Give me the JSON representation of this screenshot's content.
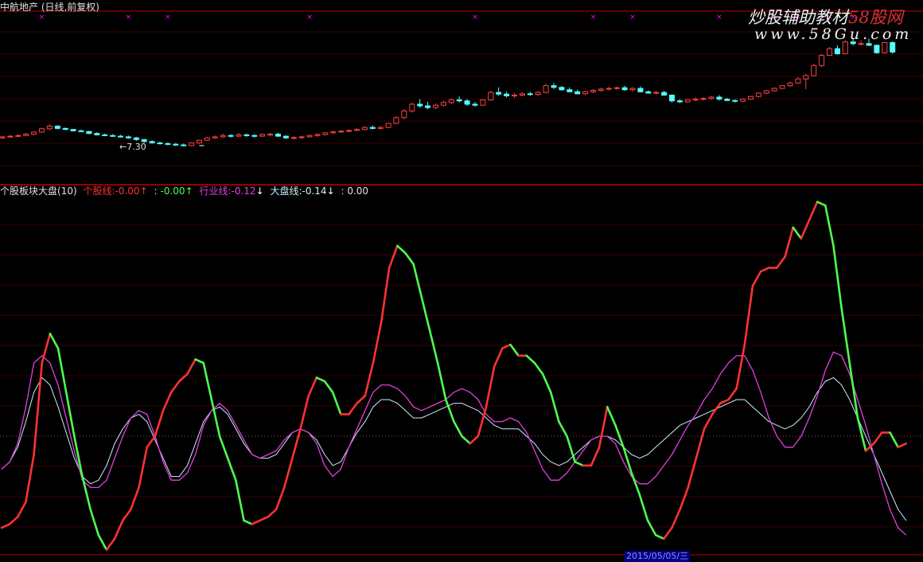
{
  "window": {
    "title": "中航地产 (日线,前复权)",
    "bottom_date": "2015/05/05/三"
  },
  "watermark": {
    "line1_part1": "炒股辅助教材",
    "line1_part2": "58股网",
    "line2": "www.58Gu.com"
  },
  "indicator_header": {
    "name": "个股板块大盘(10)",
    "items": [
      {
        "label": "个股线:",
        "value": "-0.00",
        "arrow": "↑",
        "color": "#ff3232"
      },
      {
        "label": ":",
        "value": "-0.00",
        "arrow": "↑",
        "color": "#4dff4d"
      },
      {
        "label": "行业线:",
        "value": "-0.12",
        "arrow": "↓",
        "color": "#e040e0"
      },
      {
        "label": "大盘线:",
        "value": "-0.14",
        "arrow": "↓",
        "color": "#c8f0ff"
      },
      {
        "label": ":",
        "value": "0.00",
        "arrow": "",
        "color": "#e0e0e0"
      }
    ]
  },
  "colors": {
    "stock_up": "#ff3232",
    "stock_down": "#4dff4d",
    "industry": "#e040e0",
    "market": "#c8f0ff",
    "candle_up": "#ff4040",
    "candle_down": "#54ffff",
    "divider": "#c00000",
    "grid": "#3a0000",
    "marker": "#ff00ff"
  },
  "chart_data": [
    {
      "type": "candlestick",
      "title": "中航地产 (日线,前复权)",
      "annotations": [
        {
          "text": "←7.30",
          "x": 25
        }
      ],
      "markers_x": [
        5,
        16,
        21,
        39,
        60,
        75,
        80,
        91,
        98,
        101,
        105,
        108,
        135,
        138,
        140
      ],
      "ohlc": [
        [
          7.55,
          7.6,
          7.52,
          7.58
        ],
        [
          7.58,
          7.63,
          7.55,
          7.6
        ],
        [
          7.6,
          7.65,
          7.57,
          7.62
        ],
        [
          7.62,
          7.7,
          7.6,
          7.66
        ],
        [
          7.66,
          7.75,
          7.63,
          7.72
        ],
        [
          7.72,
          7.85,
          7.7,
          7.82
        ],
        [
          7.82,
          7.95,
          7.78,
          7.9
        ],
        [
          7.9,
          7.92,
          7.8,
          7.83
        ],
        [
          7.83,
          7.86,
          7.78,
          7.8
        ],
        [
          7.8,
          7.82,
          7.74,
          7.76
        ],
        [
          7.76,
          7.8,
          7.72,
          7.74
        ],
        [
          7.74,
          7.76,
          7.66,
          7.68
        ],
        [
          7.68,
          7.72,
          7.62,
          7.64
        ],
        [
          7.64,
          7.68,
          7.6,
          7.62
        ],
        [
          7.62,
          7.66,
          7.58,
          7.6
        ],
        [
          7.6,
          7.64,
          7.56,
          7.58
        ],
        [
          7.58,
          7.62,
          7.52,
          7.55
        ],
        [
          7.55,
          7.58,
          7.46,
          7.5
        ],
        [
          7.5,
          7.52,
          7.4,
          7.44
        ],
        [
          7.44,
          7.48,
          7.38,
          7.4
        ],
        [
          7.4,
          7.44,
          7.35,
          7.38
        ],
        [
          7.38,
          7.42,
          7.33,
          7.36
        ],
        [
          7.36,
          7.4,
          7.31,
          7.34
        ],
        [
          7.34,
          7.38,
          7.3,
          7.32
        ],
        [
          7.32,
          7.42,
          7.3,
          7.4
        ],
        [
          7.4,
          7.5,
          7.38,
          7.48
        ],
        [
          7.48,
          7.58,
          7.46,
          7.55
        ],
        [
          7.55,
          7.62,
          7.52,
          7.58
        ],
        [
          7.58,
          7.68,
          7.55,
          7.62
        ],
        [
          7.62,
          7.66,
          7.56,
          7.6
        ],
        [
          7.6,
          7.7,
          7.58,
          7.64
        ],
        [
          7.64,
          7.68,
          7.58,
          7.62
        ],
        [
          7.62,
          7.66,
          7.56,
          7.6
        ],
        [
          7.6,
          7.68,
          7.58,
          7.65
        ],
        [
          7.65,
          7.7,
          7.6,
          7.66
        ],
        [
          7.66,
          7.7,
          7.58,
          7.6
        ],
        [
          7.6,
          7.62,
          7.52,
          7.55
        ],
        [
          7.55,
          7.6,
          7.5,
          7.56
        ],
        [
          7.56,
          7.62,
          7.52,
          7.58
        ],
        [
          7.58,
          7.64,
          7.55,
          7.62
        ],
        [
          7.62,
          7.68,
          7.58,
          7.65
        ],
        [
          7.65,
          7.72,
          7.62,
          7.7
        ],
        [
          7.7,
          7.76,
          7.66,
          7.73
        ],
        [
          7.73,
          7.78,
          7.7,
          7.75
        ],
        [
          7.75,
          7.8,
          7.72,
          7.77
        ],
        [
          7.77,
          7.84,
          7.74,
          7.8
        ],
        [
          7.8,
          7.9,
          7.78,
          7.86
        ],
        [
          7.86,
          7.92,
          7.8,
          7.83
        ],
        [
          7.83,
          7.9,
          7.8,
          7.86
        ],
        [
          7.86,
          8.0,
          7.84,
          7.98
        ],
        [
          7.98,
          8.2,
          7.96,
          8.15
        ],
        [
          8.15,
          8.4,
          8.1,
          8.35
        ],
        [
          8.35,
          8.6,
          8.3,
          8.55
        ],
        [
          8.55,
          8.7,
          8.45,
          8.5
        ],
        [
          8.5,
          8.62,
          8.4,
          8.45
        ],
        [
          8.45,
          8.58,
          8.4,
          8.52
        ],
        [
          8.52,
          8.66,
          8.48,
          8.6
        ],
        [
          8.6,
          8.72,
          8.55,
          8.68
        ],
        [
          8.68,
          8.78,
          8.6,
          8.65
        ],
        [
          8.65,
          8.7,
          8.5,
          8.55
        ],
        [
          8.55,
          8.62,
          8.48,
          8.52
        ],
        [
          8.52,
          8.7,
          8.5,
          8.68
        ],
        [
          8.68,
          8.95,
          8.65,
          8.9
        ],
        [
          8.9,
          9.05,
          8.8,
          8.85
        ],
        [
          8.85,
          8.92,
          8.75,
          8.8
        ],
        [
          8.8,
          8.88,
          8.74,
          8.82
        ],
        [
          8.82,
          8.9,
          8.78,
          8.86
        ],
        [
          8.86,
          8.92,
          8.8,
          8.84
        ],
        [
          8.84,
          8.94,
          8.8,
          8.9
        ],
        [
          8.9,
          9.15,
          8.88,
          9.1
        ],
        [
          9.1,
          9.18,
          9.0,
          9.05
        ],
        [
          9.05,
          9.1,
          8.95,
          8.98
        ],
        [
          8.98,
          9.05,
          8.9,
          8.92
        ],
        [
          8.92,
          8.98,
          8.84,
          8.86
        ],
        [
          8.86,
          8.95,
          8.82,
          8.92
        ],
        [
          8.92,
          9.0,
          8.88,
          8.96
        ],
        [
          8.96,
          9.04,
          8.92,
          9.0
        ],
        [
          9.0,
          9.06,
          8.96,
          9.02
        ],
        [
          9.02,
          9.08,
          8.98,
          9.04
        ],
        [
          9.04,
          9.1,
          8.95,
          8.98
        ],
        [
          8.98,
          9.05,
          8.92,
          9.02
        ],
        [
          9.02,
          9.08,
          8.9,
          8.92
        ],
        [
          8.92,
          8.96,
          8.86,
          8.88
        ],
        [
          8.88,
          8.94,
          8.84,
          8.9
        ],
        [
          8.9,
          8.95,
          8.8,
          8.82
        ],
        [
          8.82,
          8.84,
          8.6,
          8.65
        ],
        [
          8.65,
          8.7,
          8.58,
          8.62
        ],
        [
          8.62,
          8.7,
          8.6,
          8.68
        ],
        [
          8.68,
          8.75,
          8.64,
          8.7
        ],
        [
          8.7,
          8.76,
          8.65,
          8.72
        ],
        [
          8.72,
          8.8,
          8.68,
          8.76
        ],
        [
          8.76,
          8.82,
          8.66,
          8.7
        ],
        [
          8.7,
          8.74,
          8.64,
          8.66
        ],
        [
          8.66,
          8.7,
          8.6,
          8.64
        ],
        [
          8.64,
          8.72,
          8.62,
          8.7
        ],
        [
          8.7,
          8.8,
          8.68,
          8.78
        ],
        [
          8.78,
          8.9,
          8.76,
          8.88
        ],
        [
          8.88,
          8.98,
          8.85,
          8.95
        ],
        [
          8.95,
          9.05,
          8.92,
          9.02
        ],
        [
          9.02,
          9.12,
          9.0,
          9.1
        ],
        [
          9.1,
          9.22,
          9.06,
          9.18
        ],
        [
          9.18,
          9.35,
          9.15,
          9.3
        ],
        [
          9.3,
          9.45,
          9.0,
          9.4
        ],
        [
          9.4,
          9.75,
          9.38,
          9.7
        ],
        [
          9.7,
          10.05,
          9.65,
          10.0
        ],
        [
          10.0,
          10.25,
          9.98,
          10.2
        ],
        [
          10.2,
          10.3,
          10.02,
          10.05
        ],
        [
          10.05,
          10.45,
          10.03,
          10.4
        ],
        [
          10.4,
          10.5,
          10.3,
          10.35
        ],
        [
          10.35,
          10.45,
          10.3,
          10.35
        ],
        [
          10.35,
          10.5,
          10.28,
          10.3
        ],
        [
          10.3,
          10.32,
          10.05,
          10.08
        ],
        [
          10.08,
          10.4,
          10.06,
          10.38
        ],
        [
          10.38,
          10.42,
          10.05,
          10.1
        ]
      ]
    },
    {
      "type": "line",
      "title": "个股板块大盘(10)",
      "baseline": 0,
      "ylim": [
        -0.5,
        0.57
      ],
      "series": [
        {
          "name": "个股线",
          "color_rule": "red when rising, green when falling",
          "values": [
            -0.25,
            -0.24,
            -0.22,
            -0.18,
            -0.05,
            0.2,
            0.28,
            0.24,
            0.12,
            0.0,
            -0.11,
            -0.2,
            -0.27,
            -0.31,
            -0.28,
            -0.23,
            -0.2,
            -0.14,
            -0.03,
            0.0,
            0.07,
            0.12,
            0.15,
            0.17,
            0.21,
            0.2,
            0.1,
            0.0,
            -0.06,
            -0.12,
            -0.23,
            -0.24,
            -0.23,
            -0.22,
            -0.2,
            -0.14,
            -0.06,
            0.02,
            0.11,
            0.16,
            0.15,
            0.12,
            0.06,
            0.06,
            0.09,
            0.11,
            0.2,
            0.31,
            0.46,
            0.52,
            0.5,
            0.47,
            0.38,
            0.29,
            0.2,
            0.1,
            0.04,
            0.0,
            -0.02,
            0.0,
            0.08,
            0.19,
            0.24,
            0.25,
            0.22,
            0.22,
            0.2,
            0.17,
            0.12,
            0.04,
            0.0,
            -0.07,
            -0.08,
            -0.08,
            -0.03,
            0.08,
            0.03,
            -0.03,
            -0.1,
            -0.16,
            -0.23,
            -0.27,
            -0.28,
            -0.25,
            -0.2,
            -0.14,
            -0.06,
            0.02,
            0.06,
            0.09,
            0.1,
            0.13,
            0.25,
            0.41,
            0.45,
            0.46,
            0.46,
            0.49,
            0.57,
            0.54,
            0.59,
            0.64,
            0.63,
            0.52,
            0.35,
            0.2,
            0.05,
            -0.04,
            -0.02,
            0.01,
            0.01,
            -0.03,
            -0.02
          ]
        },
        {
          "name": "行业线",
          "values": [
            -0.09,
            -0.07,
            -0.02,
            0.08,
            0.2,
            0.22,
            0.2,
            0.14,
            0.05,
            -0.04,
            -0.12,
            -0.14,
            -0.14,
            -0.12,
            -0.06,
            0.0,
            0.05,
            0.07,
            0.06,
            0.0,
            -0.07,
            -0.12,
            -0.12,
            -0.1,
            -0.05,
            0.03,
            0.07,
            0.09,
            0.07,
            0.03,
            -0.01,
            -0.05,
            -0.06,
            -0.05,
            -0.04,
            -0.01,
            0.01,
            0.02,
            0.01,
            -0.02,
            -0.08,
            -0.11,
            -0.09,
            -0.03,
            0.02,
            0.07,
            0.12,
            0.14,
            0.14,
            0.13,
            0.11,
            0.08,
            0.07,
            0.08,
            0.09,
            0.1,
            0.12,
            0.13,
            0.12,
            0.1,
            0.06,
            0.04,
            0.04,
            0.05,
            0.04,
            0.01,
            -0.04,
            -0.09,
            -0.12,
            -0.12,
            -0.1,
            -0.07,
            -0.04,
            -0.01,
            0.0,
            0.0,
            -0.02,
            -0.07,
            -0.11,
            -0.13,
            -0.13,
            -0.11,
            -0.08,
            -0.05,
            -0.01,
            0.03,
            0.06,
            0.1,
            0.13,
            0.17,
            0.2,
            0.22,
            0.22,
            0.18,
            0.12,
            0.05,
            0.0,
            -0.03,
            -0.03,
            0.0,
            0.05,
            0.11,
            0.18,
            0.23,
            0.22,
            0.17,
            0.1,
            0.03,
            -0.05,
            -0.13,
            -0.2,
            -0.25,
            -0.27
          ]
        },
        {
          "name": "大盘线",
          "values": [
            -0.09,
            -0.07,
            -0.03,
            0.04,
            0.12,
            0.16,
            0.14,
            0.08,
            0.01,
            -0.06,
            -0.11,
            -0.13,
            -0.12,
            -0.08,
            -0.02,
            0.02,
            0.05,
            0.06,
            0.04,
            -0.01,
            -0.06,
            -0.11,
            -0.11,
            -0.08,
            -0.02,
            0.04,
            0.07,
            0.08,
            0.06,
            0.02,
            -0.02,
            -0.05,
            -0.06,
            -0.06,
            -0.05,
            -0.02,
            0.01,
            0.02,
            0.01,
            -0.01,
            -0.05,
            -0.08,
            -0.07,
            -0.03,
            0.01,
            0.04,
            0.08,
            0.1,
            0.1,
            0.09,
            0.07,
            0.05,
            0.05,
            0.06,
            0.07,
            0.08,
            0.09,
            0.09,
            0.08,
            0.07,
            0.05,
            0.03,
            0.02,
            0.02,
            0.02,
            0.0,
            -0.02,
            -0.05,
            -0.07,
            -0.08,
            -0.07,
            -0.05,
            -0.03,
            -0.01,
            0.0,
            0.0,
            -0.01,
            -0.03,
            -0.05,
            -0.06,
            -0.05,
            -0.03,
            -0.01,
            0.01,
            0.03,
            0.04,
            0.05,
            0.06,
            0.07,
            0.08,
            0.09,
            0.1,
            0.1,
            0.08,
            0.06,
            0.04,
            0.03,
            0.02,
            0.03,
            0.05,
            0.08,
            0.12,
            0.15,
            0.16,
            0.14,
            0.1,
            0.05,
            0.0,
            -0.05,
            -0.1,
            -0.15,
            -0.2,
            -0.23
          ]
        }
      ]
    }
  ]
}
